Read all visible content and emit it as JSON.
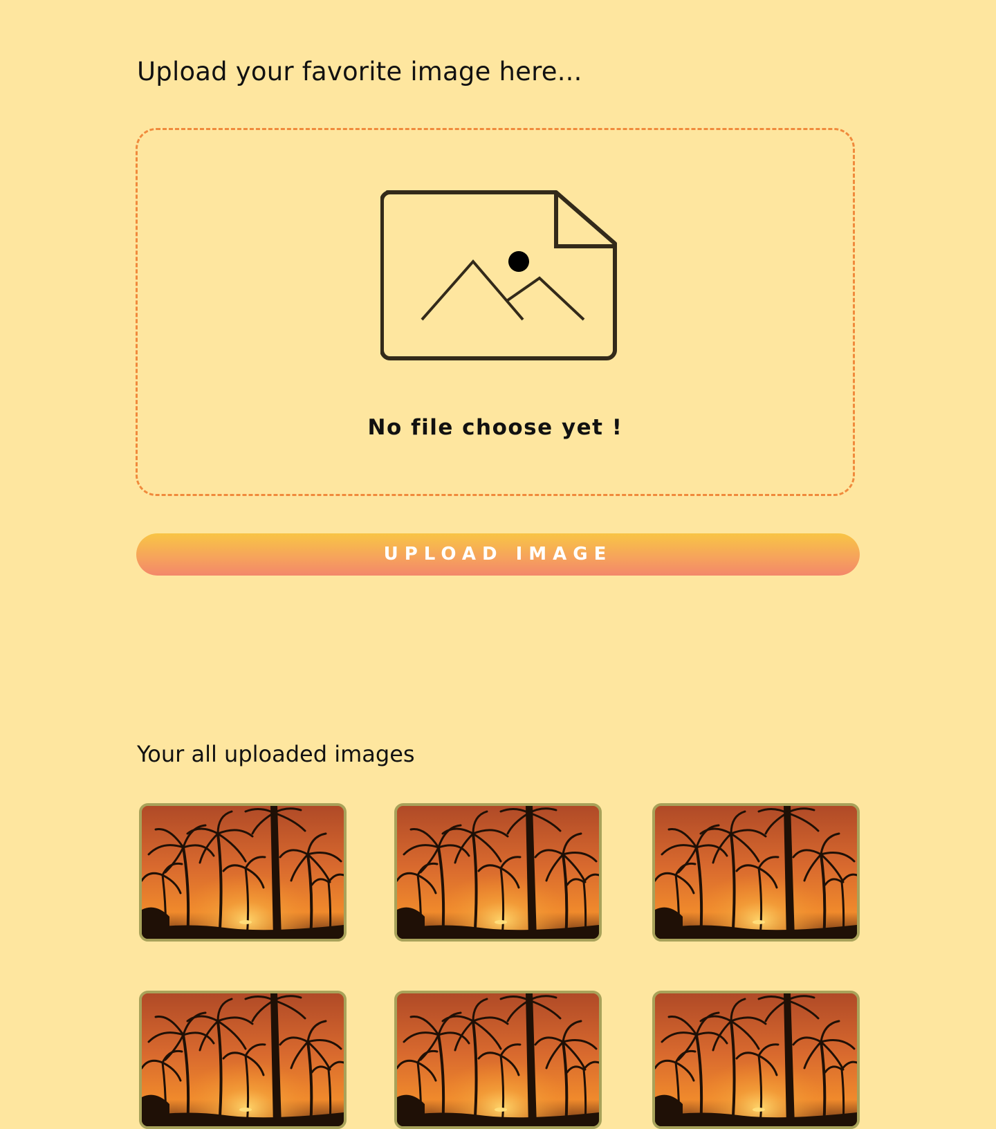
{
  "upload_section": {
    "heading": "Upload your favorite image here...",
    "dropzone": {
      "icon": "image-file-icon",
      "status_text": "No file choose yet !"
    },
    "button_label": "UPLOAD IMAGE"
  },
  "gallery": {
    "heading": "Your all uploaded images",
    "images": [
      {
        "icon": "palm-sunset-photo"
      },
      {
        "icon": "palm-sunset-photo"
      },
      {
        "icon": "palm-sunset-photo"
      },
      {
        "icon": "palm-sunset-photo"
      },
      {
        "icon": "palm-sunset-photo"
      },
      {
        "icon": "palm-sunset-photo"
      }
    ]
  },
  "colors": {
    "background": "#fee69f",
    "dropzone_border": "#f08a3c",
    "button_gradient_top": "#f8c545",
    "button_gradient_bottom": "#f3876a",
    "thumbnail_border": "#a8a25a",
    "icon_stroke": "#332a1a"
  }
}
